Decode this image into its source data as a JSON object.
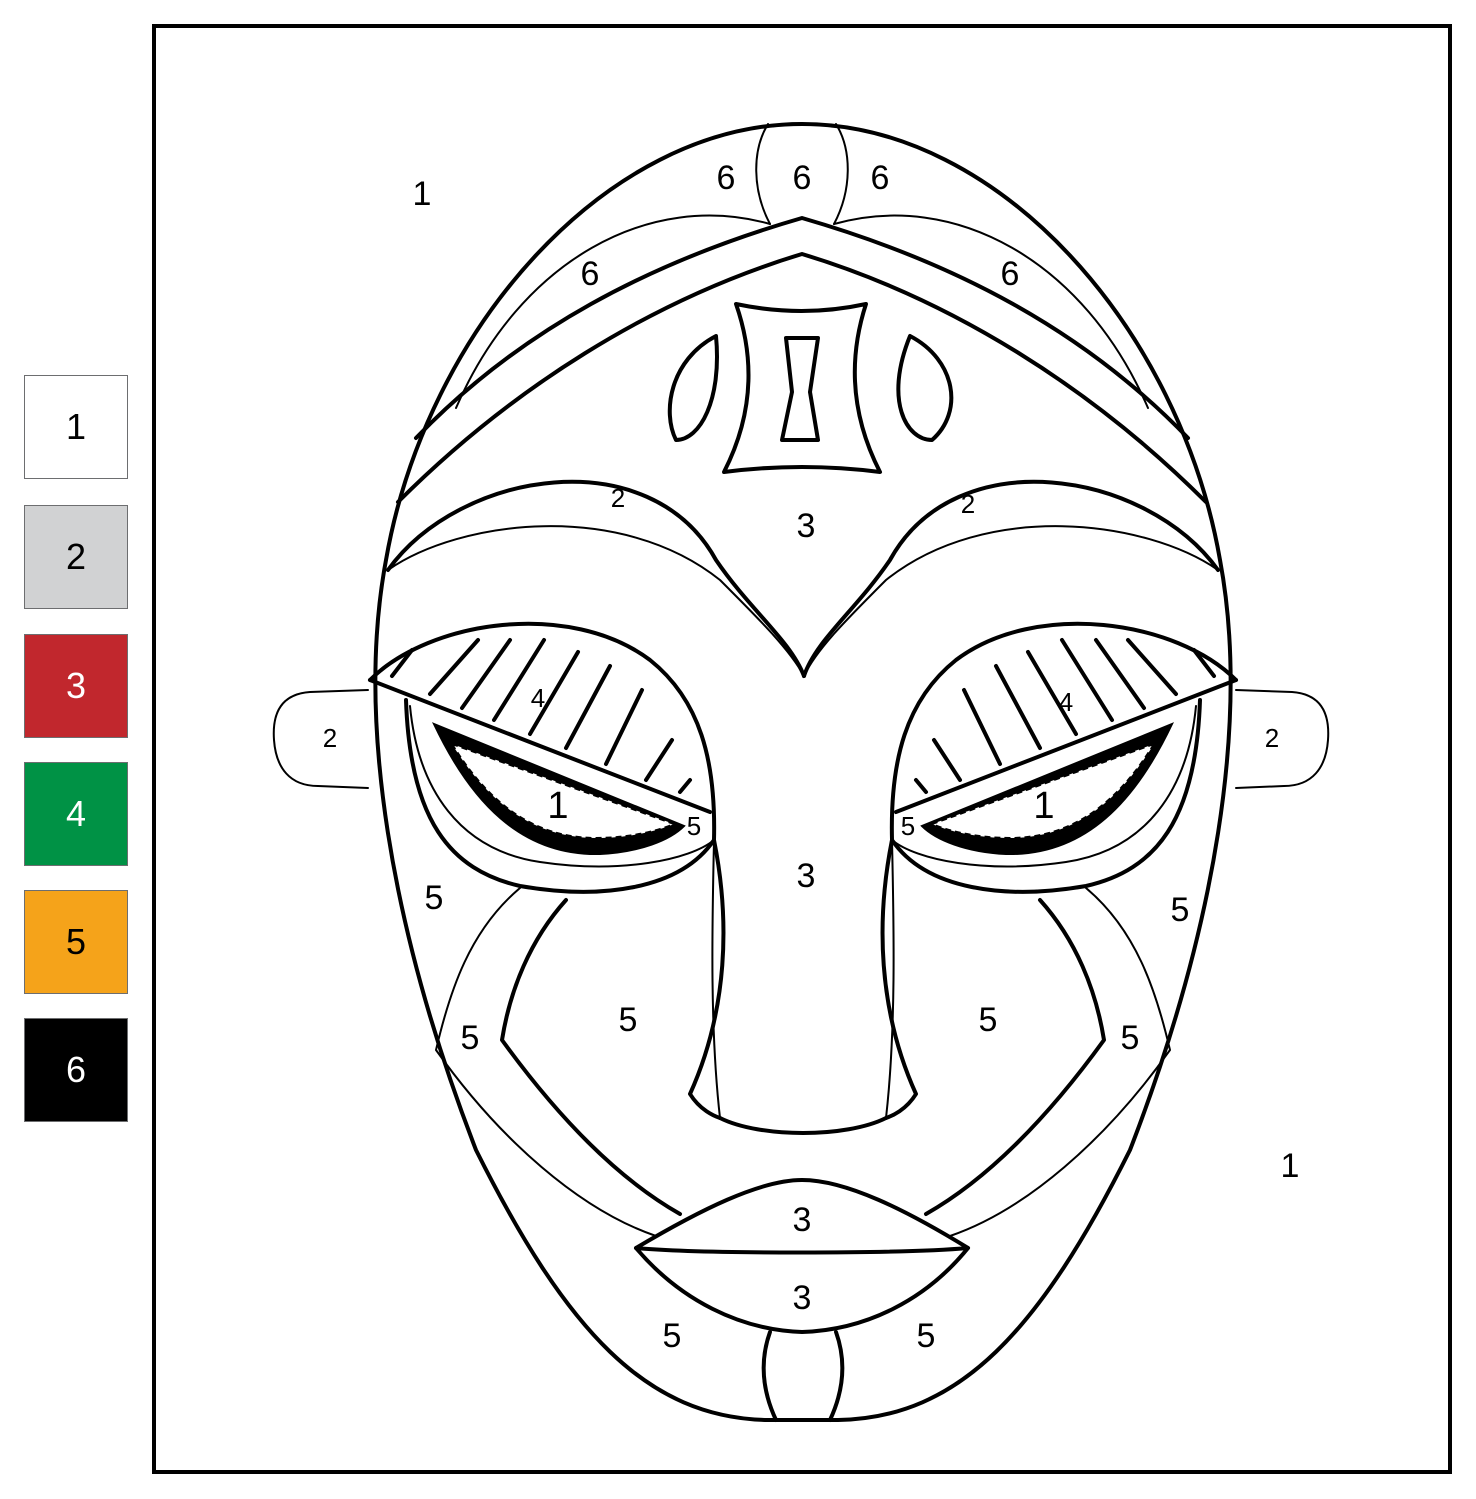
{
  "legend": [
    {
      "number": "1",
      "color": "#ffffff",
      "text_color": "#000000"
    },
    {
      "number": "2",
      "color": "#d1d2d3",
      "text_color": "#000000"
    },
    {
      "number": "3",
      "color": "#c1272d",
      "text_color": "#ffffff"
    },
    {
      "number": "4",
      "color": "#009245",
      "text_color": "#ffffff"
    },
    {
      "number": "5",
      "color": "#f5a31a",
      "text_color": "#000000"
    },
    {
      "number": "6",
      "color": "#000000",
      "text_color": "#ffffff"
    }
  ],
  "region_labels": {
    "background_top": "1",
    "background_bottom": "1",
    "crown_left": "6",
    "crown_center": "6",
    "crown_right": "6",
    "band_left": "6",
    "band_right": "6",
    "brow_left": "2",
    "brow_right": "2",
    "forehead": "3",
    "ear_left": "2",
    "ear_right": "2",
    "lid_left": "4",
    "lid_right": "4",
    "eye_left": "1",
    "eye_right": "1",
    "eye_corner_left": "5",
    "eye_corner_right": "5",
    "nose": "3",
    "cheek_outer_left": "5",
    "cheek_outer_right": "5",
    "cheek_lower_left": "5",
    "cheek_lower_right": "5",
    "cheek_inner_left": "5",
    "cheek_inner_right": "5",
    "lip_upper": "3",
    "lip_lower": "3",
    "chin_left": "5",
    "chin_right": "5"
  }
}
